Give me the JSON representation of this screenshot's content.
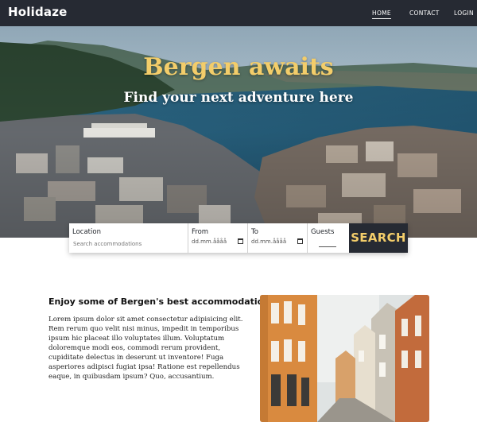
{
  "nav": {
    "brand": "Holidaze",
    "links": [
      {
        "label": "HOME",
        "active": true
      },
      {
        "label": "CONTACT",
        "active": false
      },
      {
        "label": "LOGIN",
        "active": false
      }
    ]
  },
  "hero": {
    "title": "Bergen awaits",
    "subtitle": "Find your next adventure here"
  },
  "search": {
    "location_label": "Location",
    "location_placeholder": "Search accommodations",
    "from_label": "From",
    "from_value": "dd.mm.åååå",
    "to_label": "To",
    "to_value": "dd.mm.åååå",
    "guests_label": "Guests",
    "button_label": "SEARCH"
  },
  "content": {
    "title": "Enjoy some of Bergen's best accommodations",
    "body": "Lorem ipsum dolor sit amet consectetur adipisicing elit. Rem rerum quo velit nisi minus, impedit in temporibus ipsum hic placeat illo voluptates illum. Voluptatum doloremque modi eos, commodi rerum provident, cupiditate delectus in deserunt ut inventore! Fuga asperiores adipisci fugiat ipsa! Ratione est repellendus eaque, in quibusdam ipsum? Quo, accusantium."
  },
  "colors": {
    "nav_bg": "#262a33",
    "accent": "#f3cd6a",
    "text": "#1f2329"
  },
  "icons": {
    "calendar": "calendar-icon"
  }
}
